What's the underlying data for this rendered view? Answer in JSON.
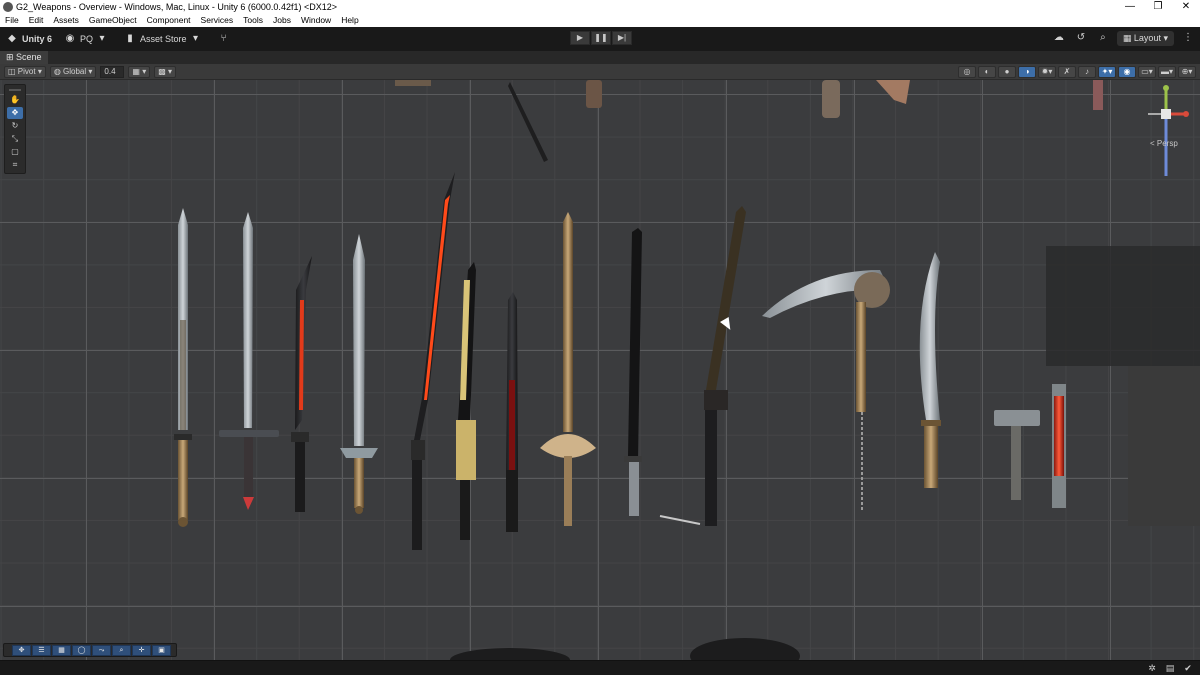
{
  "window": {
    "title": "G2_Weapons - Overview - Windows, Mac, Linux - Unity 6 (6000.0.42f1) <DX12>",
    "minimize": "—",
    "restore": "❐",
    "close": "✕"
  },
  "menu": [
    "File",
    "Edit",
    "Assets",
    "GameObject",
    "Component",
    "Services",
    "Tools",
    "Jobs",
    "Window",
    "Help"
  ],
  "toolbar": {
    "unity_label": "Unity 6",
    "account_label": "PQ",
    "asset_store_label": "Asset Store",
    "layout_label": "Layout"
  },
  "scene_tab": {
    "label": "Scene"
  },
  "scene_toolbar": {
    "pivot_label": "Pivot",
    "global_label": "Global",
    "grid_size": "0.4"
  },
  "gizmo": {
    "persp_label": "< Persp"
  },
  "icons": {
    "search": "search-icon",
    "cloud": "cloud-icon",
    "history": "history-icon",
    "settings": "settings-icon"
  }
}
